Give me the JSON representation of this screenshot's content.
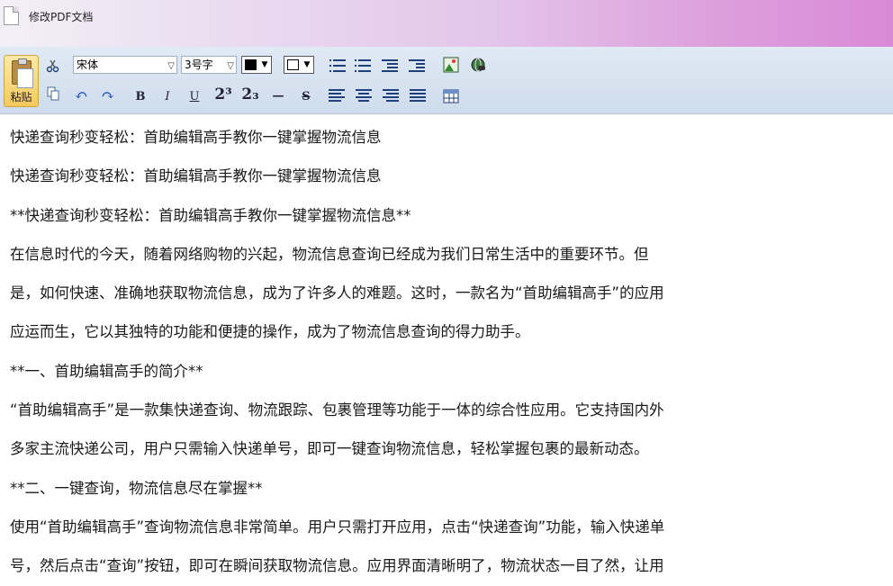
{
  "window": {
    "title": "修改PDF文档"
  },
  "toolbar": {
    "paste_label": "粘贴",
    "font_name": "宋体",
    "font_size": "3号字",
    "text_color": "#000000",
    "bg_color": "#ffffff",
    "bold": "B",
    "italic": "I",
    "underline": "U",
    "superscript": "2³",
    "subscript": "2₃",
    "hr": "—",
    "strike": "S"
  },
  "document": {
    "paragraphs": [
      "快递查询秒变轻松：首助编辑高手教你一键掌握物流信息",
      "快递查询秒变轻松：首助编辑高手教你一键掌握物流信息",
      "**快递查询秒变轻松：首助编辑高手教你一键掌握物流信息**",
      "在信息时代的今天，随着网络购物的兴起，物流信息查询已经成为我们日常生活中的重要环节。但",
      "是，如何快速、准确地获取物流信息，成为了许多人的难题。这时，一款名为“首助编辑高手”的应用",
      "应运而生，它以其独特的功能和便捷的操作，成为了物流信息查询的得力助手。",
      "**一、首助编辑高手的简介**",
      "“首助编辑高手”是一款集快递查询、物流跟踪、包裹管理等功能于一体的综合性应用。它支持国内外",
      "多家主流快递公司，用户只需输入快递单号，即可一键查询物流信息，轻松掌握包裹的最新动态。",
      "**二、一键查询，物流信息尽在掌握**",
      "使用“首助编辑高手”查询物流信息非常简单。用户只需打开应用，点击“快递查询”功能，输入快递单",
      "号，然后点击“查询”按钮，即可在瞬间获取物流信息。应用界面清晰明了，物流状态一目了然，让用"
    ]
  }
}
